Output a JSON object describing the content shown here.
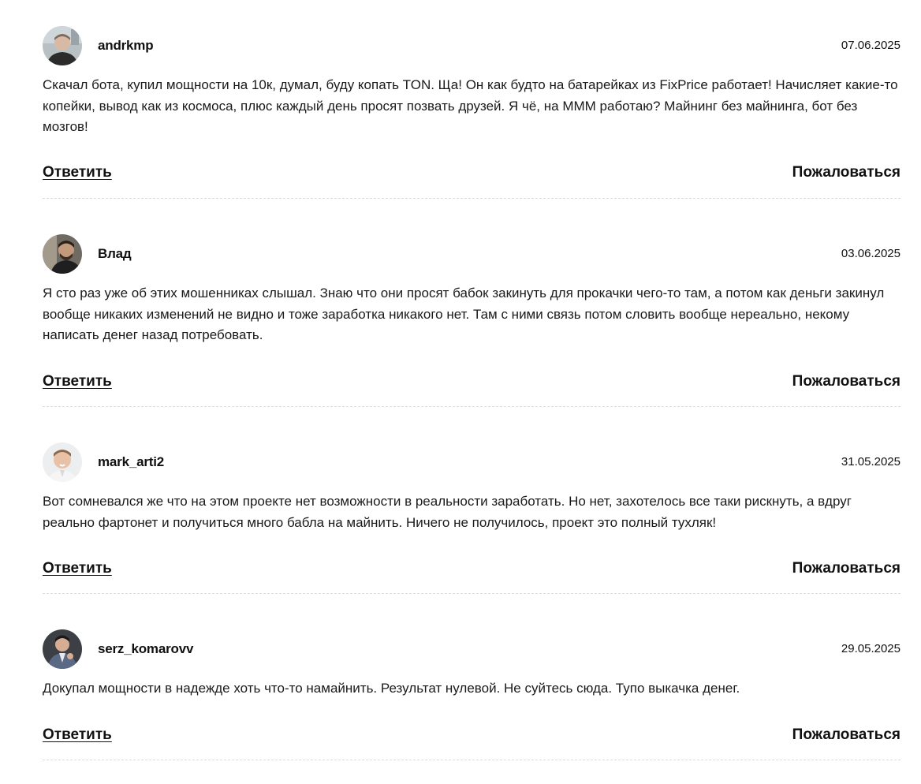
{
  "comments": [
    {
      "username": "andrkmp",
      "date": "07.06.2025",
      "text": "Скачал бота, купил мощности на 10к, думал, буду копать TON. Ща! Он как будто на батарейках из FixPrice работает! Начисляет какие-то копейки, вывод как из космоса, плюс каждый день просят позвать друзей. Я чё, на МММ работаю? Майнинг без майнинга, бот без мозгов!",
      "reply_label": "Ответить",
      "report_label": "Пожаловаться"
    },
    {
      "username": "Влад",
      "date": "03.06.2025",
      "text": "Я сто раз уже об этих мошенниках слышал. Знаю что они просят бабок закинуть для прокачки чего-то там, а потом как деньги закинул вообще никаких изменений не видно и тоже заработка никакого нет. Там с ними связь потом словить вообще нереально, некому написать денег назад потребовать.",
      "reply_label": "Ответить",
      "report_label": "Пожаловаться"
    },
    {
      "username": "mark_arti2",
      "date": "31.05.2025",
      "text": "Вот сомневался же что на этом проекте нет возможности в реальности заработать. Но нет, захотелось все таки рискнуть, а вдруг реально фартонет и получиться много бабла на майнить. Ничего не получилось, проект это полный тухляк!",
      "reply_label": "Ответить",
      "report_label": "Пожаловаться"
    },
    {
      "username": "serz_komarovv",
      "date": "29.05.2025",
      "text": "Докупал мощности в надежде хоть что-то намайнить. Результат нулевой. Не суйтесь сюда. Тупо выкачка денег.",
      "reply_label": "Ответить",
      "report_label": "Пожаловаться"
    }
  ]
}
